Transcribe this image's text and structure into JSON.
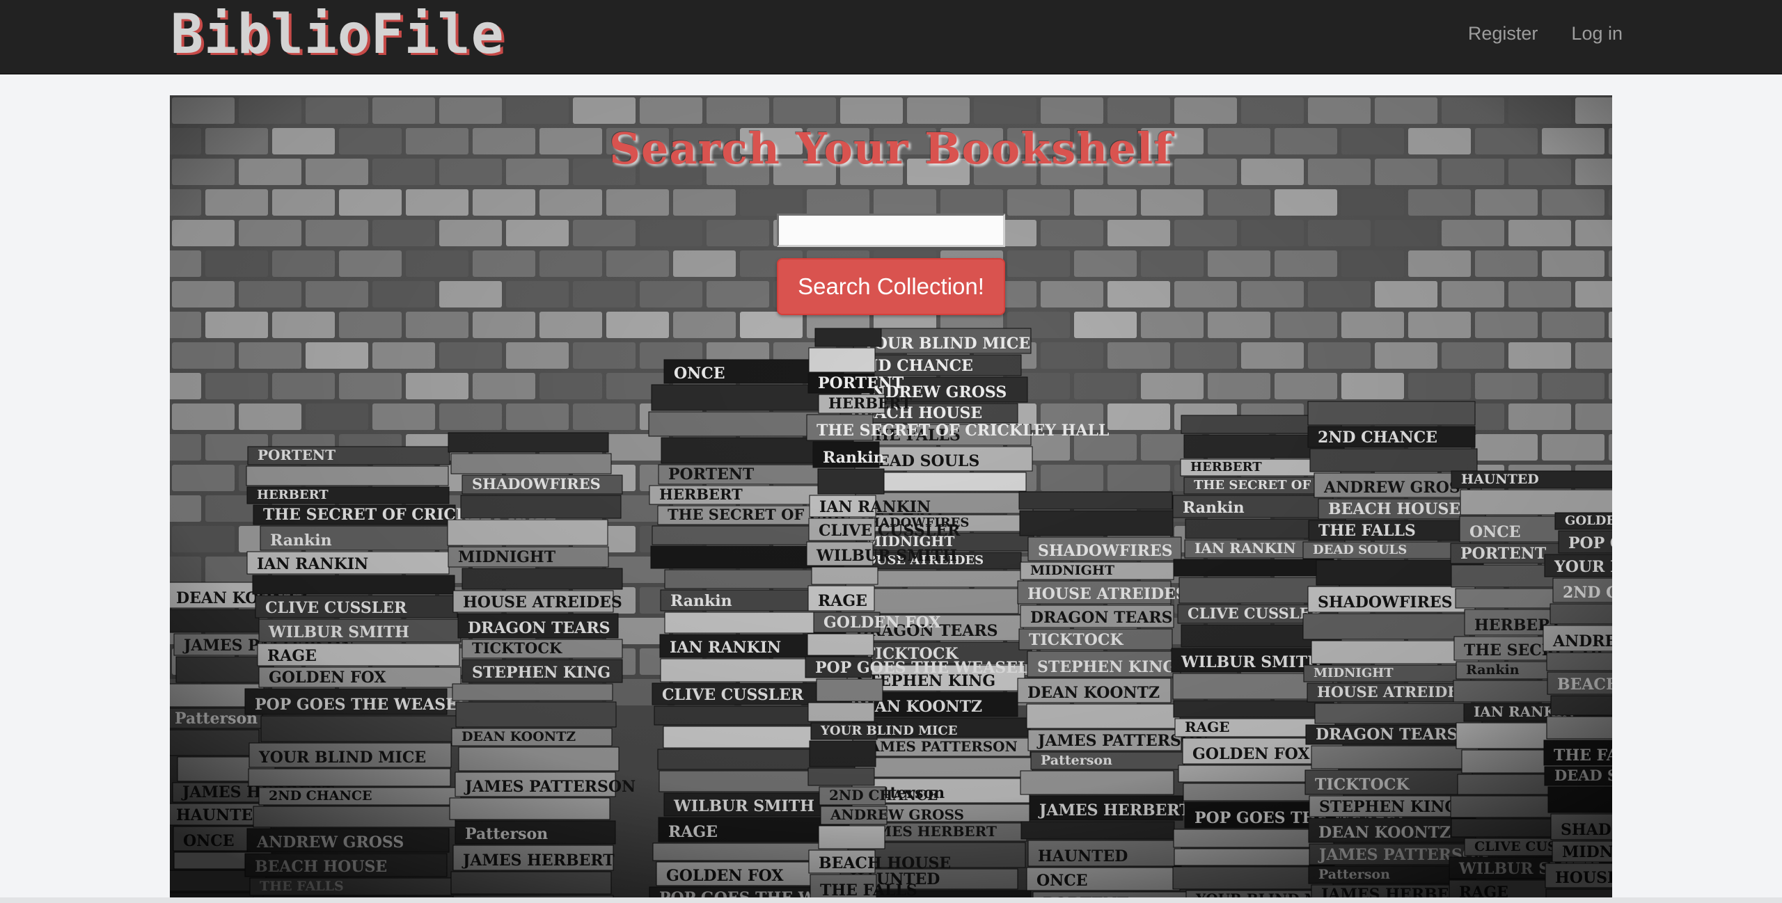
{
  "navbar": {
    "brand": "BiblioFile",
    "links": [
      "Register",
      "Log in"
    ]
  },
  "hero": {
    "title": "Search Your Bookshelf",
    "search_placeholder": "",
    "search_button": "Search Collection!",
    "background_image": "black-and-white photo of stacked books in front of a brick wall"
  },
  "book_spines": [
    "DEAN KOONTZ",
    "JAMES PATTERSON",
    "Patterson",
    "JAMES HERBERT",
    "HAUNTED",
    "ONCE",
    "PORTENT",
    "HERBERT",
    "THE SECRET OF CRICKLEY HALL",
    "Rankin",
    "IAN RANKIN",
    "CLIVE CUSSLER",
    "WILBUR SMITH",
    "RAGE",
    "GOLDEN FOX",
    "POP GOES THE WEASEL",
    "YOUR BLIND MICE",
    "2ND CHANCE",
    "ANDREW GROSS",
    "BEACH HOUSE",
    "THE FALLS",
    "DEAD SOULS",
    "SHADOWFIRES",
    "MIDNIGHT",
    "HOUSE ATREIDES",
    "DRAGON TEARS",
    "TICKTOCK",
    "STEPHEN KING"
  ],
  "colors": {
    "navbar_bg": "#222222",
    "brand_shadow": "#c64a48",
    "accent_red": "#d9534f",
    "page_bg": "#f3f4f6"
  }
}
